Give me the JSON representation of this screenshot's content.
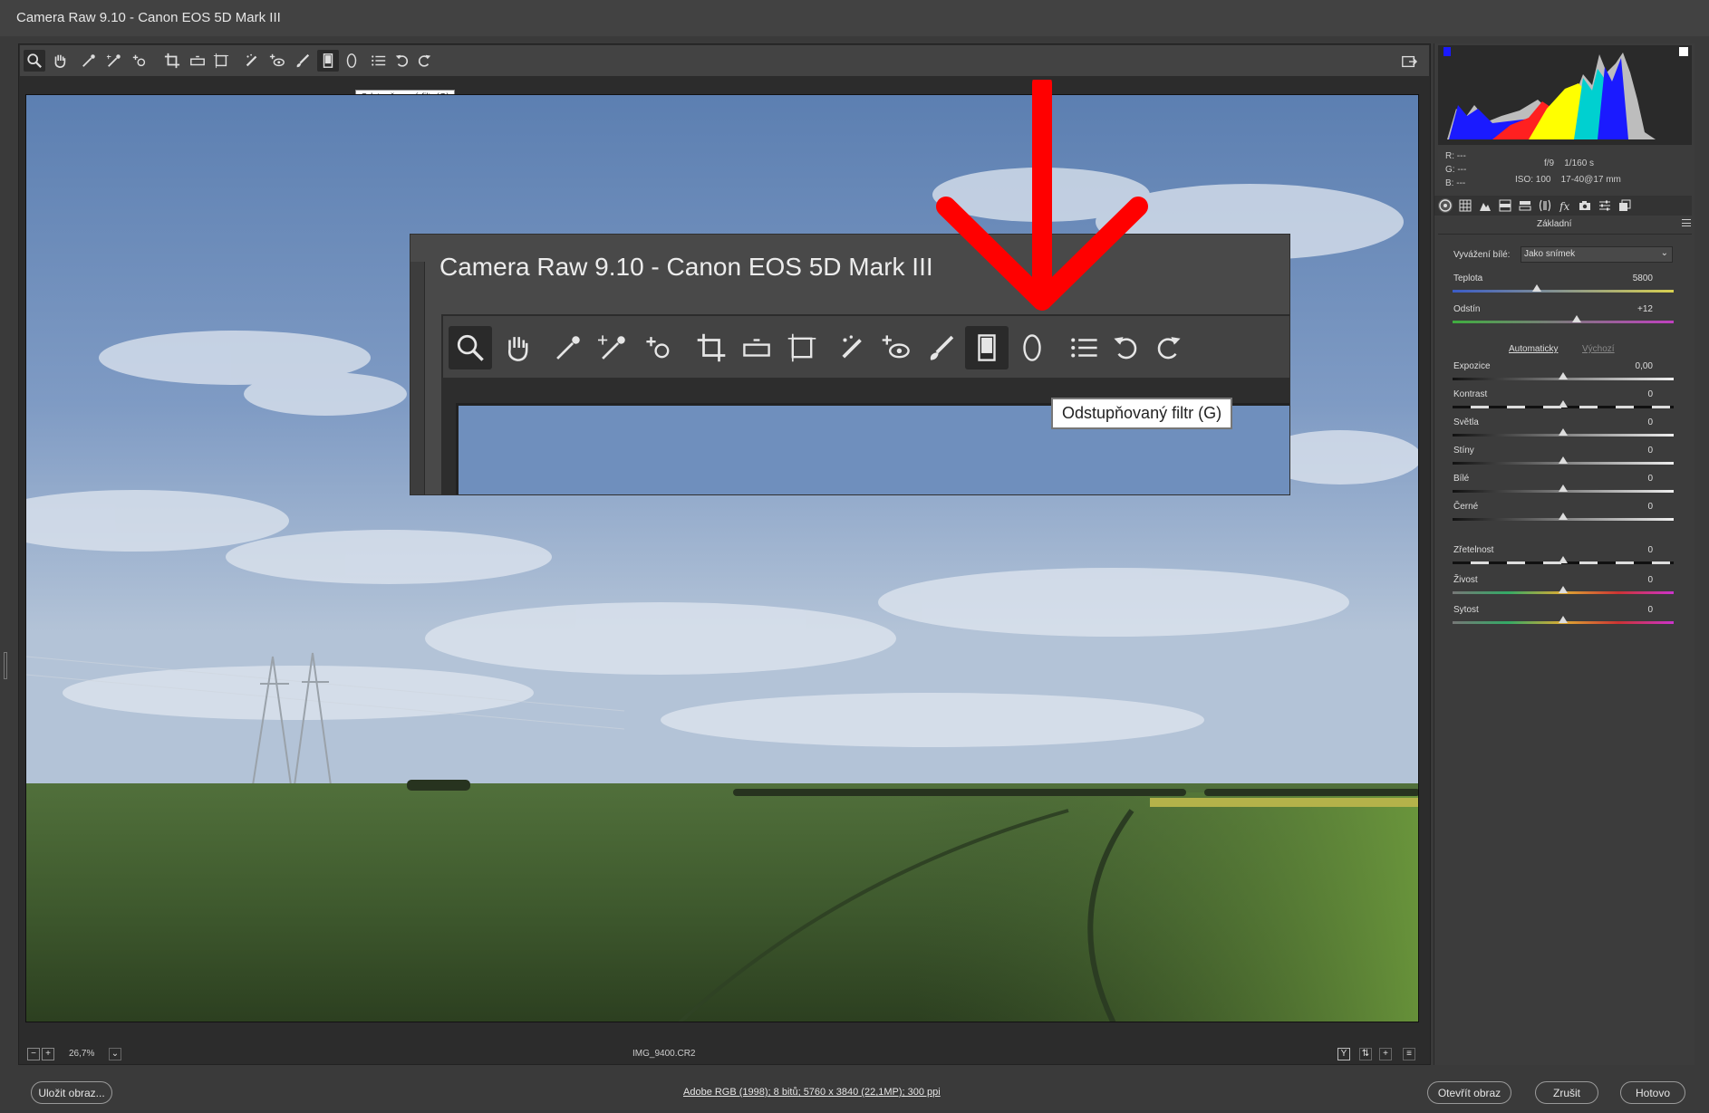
{
  "window": {
    "title": "Camera Raw 9.10  -  Canon EOS 5D Mark III"
  },
  "toolbar": {
    "tools": [
      {
        "name": "zoom-tool",
        "icon": "magnifier-icon"
      },
      {
        "name": "hand-tool",
        "icon": "hand-icon"
      },
      {
        "name": "white-balance-tool",
        "icon": "eyedropper-icon"
      },
      {
        "name": "color-sampler-tool",
        "icon": "color-sampler-icon"
      },
      {
        "name": "targeted-adjustment-tool",
        "icon": "target-icon"
      },
      {
        "name": "crop-tool",
        "icon": "crop-icon"
      },
      {
        "name": "straighten-tool",
        "icon": "level-icon"
      },
      {
        "name": "transform-tool",
        "icon": "transform-icon"
      },
      {
        "name": "spot-removal-tool",
        "icon": "brush-spot-icon"
      },
      {
        "name": "red-eye-tool",
        "icon": "red-eye-icon"
      },
      {
        "name": "adjustment-brush-tool",
        "icon": "brush-icon"
      },
      {
        "name": "graduated-filter-tool",
        "icon": "graduated-filter-icon"
      },
      {
        "name": "radial-filter-tool",
        "icon": "radial-filter-icon"
      },
      {
        "name": "preferences-tool",
        "icon": "list-icon"
      },
      {
        "name": "rotate-left-tool",
        "icon": "rotate-left-icon"
      },
      {
        "name": "rotate-right-tool",
        "icon": "rotate-right-icon"
      }
    ],
    "tooltip": "Odstupňovaný filtr (G)"
  },
  "inset": {
    "title": "Camera Raw 9.10  -  Canon EOS 5D Mark III",
    "tooltip": "Odstupňovaný filtr (G)"
  },
  "status": {
    "zoom": "26,7%",
    "filename": "IMG_9400.CR2",
    "y_button": "Y"
  },
  "bottom": {
    "save_label": "Uložit obraz...",
    "workflow_link": "Adobe RGB (1998); 8 bitů; 5760 x 3840 (22,1MP); 300 ppi",
    "open_label": "Otevřít obraz",
    "cancel_label": "Zrušit",
    "done_label": "Hotovo"
  },
  "info": {
    "r_label": "R:",
    "g_label": "G:",
    "b_label": "B:",
    "r_value": "---",
    "g_value": "---",
    "b_value": "---",
    "aperture": "f/9",
    "shutter": "1/160 s",
    "iso": "ISO: 100",
    "lens": "17-40@17 mm"
  },
  "panel": {
    "title": "Základní",
    "white_balance_label": "Vyvážení bílé:",
    "white_balance_value": "Jako snímek",
    "auto_label": "Automaticky",
    "default_label": "Výchozí",
    "sliders": [
      {
        "label": "Teplota",
        "value": "5800",
        "pos": 0.38
      },
      {
        "label": "Odstín",
        "value": "+12",
        "pos": 0.56
      },
      {
        "label": "Expozice",
        "value": "0,00",
        "pos": 0.5
      },
      {
        "label": "Kontrast",
        "value": "0",
        "pos": 0.5
      },
      {
        "label": "Světla",
        "value": "0",
        "pos": 0.5
      },
      {
        "label": "Stíny",
        "value": "0",
        "pos": 0.5
      },
      {
        "label": "Bílé",
        "value": "0",
        "pos": 0.5
      },
      {
        "label": "Černé",
        "value": "0",
        "pos": 0.5
      },
      {
        "label": "Zřetelnost",
        "value": "0",
        "pos": 0.5
      },
      {
        "label": "Živost",
        "value": "0",
        "pos": 0.5
      },
      {
        "label": "Sytost",
        "value": "0",
        "pos": 0.5
      }
    ]
  },
  "colors": {
    "accent_arrow": "#ff0000",
    "sky": "#6f8fbd",
    "grass": "#4a6b34"
  }
}
